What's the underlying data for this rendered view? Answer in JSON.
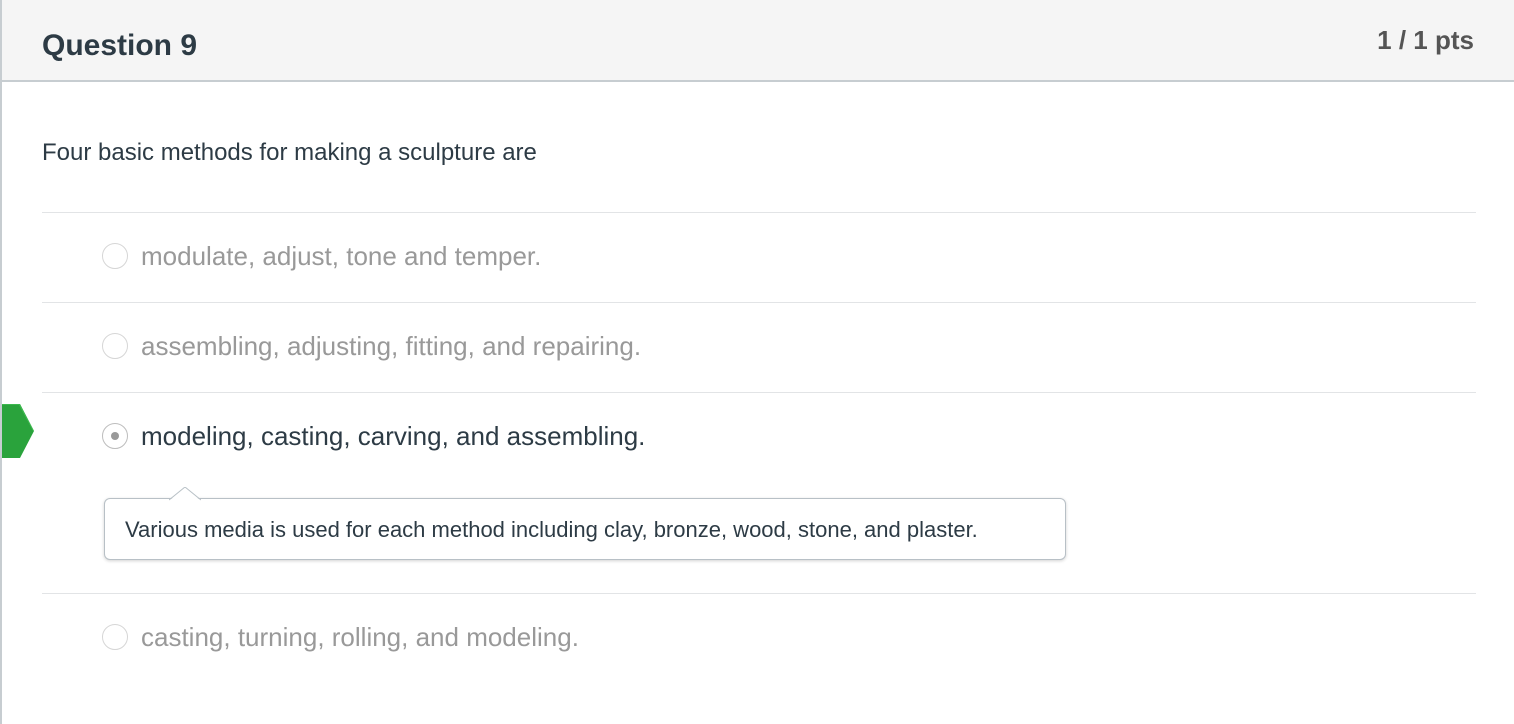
{
  "question": {
    "title": "Question 9",
    "points": "1 / 1 pts",
    "text": "Four basic methods for making a sculpture are"
  },
  "answers": [
    {
      "label": "modulate, adjust, tone and temper.",
      "selected": false,
      "correct": false
    },
    {
      "label": "assembling, adjusting, fitting, and repairing.",
      "selected": false,
      "correct": false
    },
    {
      "label": "modeling, casting, carving, and assembling.",
      "selected": true,
      "correct": true,
      "comment": "Various media is used for each method including clay, bronze, wood, stone, and plaster."
    },
    {
      "label": "casting, turning, rolling, and modeling.",
      "selected": false,
      "correct": false
    }
  ],
  "colors": {
    "correct_flag": "#2aa33c",
    "text": "#2d3b45",
    "muted_text": "#999999",
    "header_bg": "#f5f5f5"
  },
  "icons": {
    "correct_marker": "correct-answer-flag-icon",
    "radio": "radio-button-icon"
  }
}
